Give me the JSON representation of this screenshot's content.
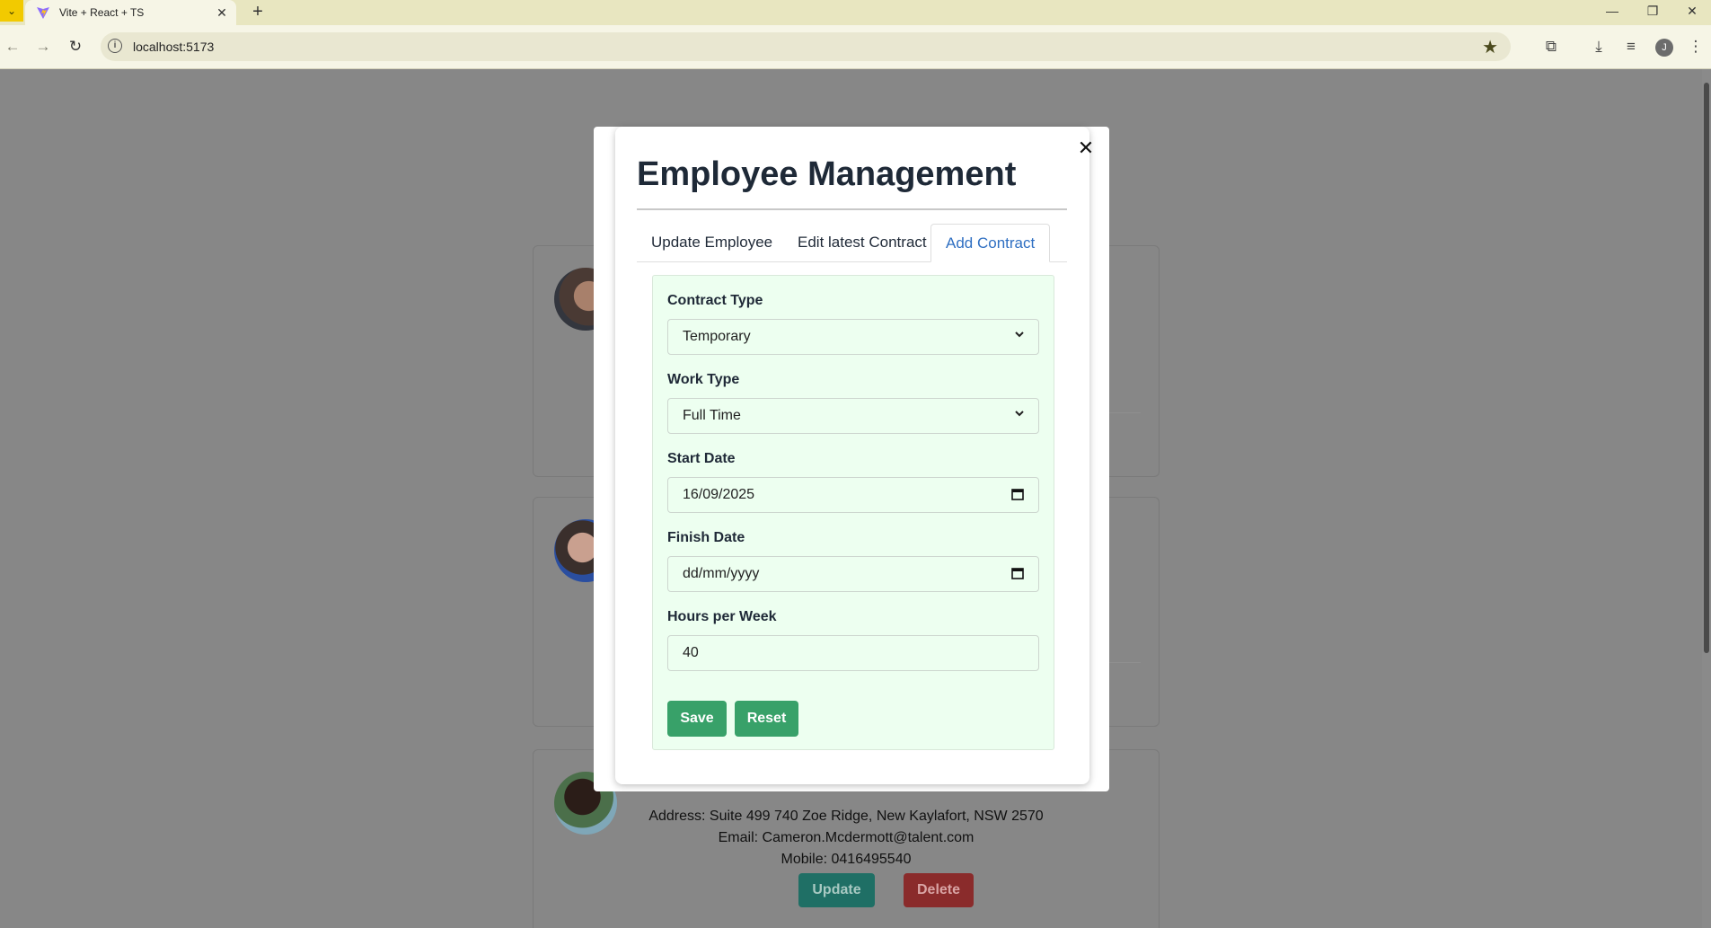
{
  "browser": {
    "tab_title": "Vite + React + TS",
    "url": "localhost:5173",
    "profile_initial": "J"
  },
  "background_card": {
    "address": "Address: Suite 499 740 Zoe Ridge, New Kaylafort, NSW 2570",
    "email": "Email: Cameron.Mcdermott@talent.com",
    "mobile": "Mobile: 0416495540",
    "update_label": "Update",
    "delete_label": "Delete"
  },
  "modal": {
    "title": "Employee Management",
    "tabs": [
      {
        "label": "Update Employee",
        "active": false
      },
      {
        "label": "Edit latest Contract",
        "active": false
      },
      {
        "label": "Add Contract",
        "active": true
      }
    ],
    "form": {
      "contract_type_label": "Contract Type",
      "contract_type_value": "Temporary",
      "work_type_label": "Work Type",
      "work_type_value": "Full Time",
      "start_date_label": "Start Date",
      "start_date_value": "16/09/2025",
      "finish_date_label": "Finish Date",
      "finish_date_value": "dd/mm/yyyy",
      "hours_label": "Hours per Week",
      "hours_value": "40",
      "save_label": "Save",
      "reset_label": "Reset"
    }
  },
  "colors": {
    "accent_green": "#38a169",
    "active_tab_blue": "#2f6fc2",
    "panel_bg": "#edfff0",
    "overlay": "#878787"
  }
}
